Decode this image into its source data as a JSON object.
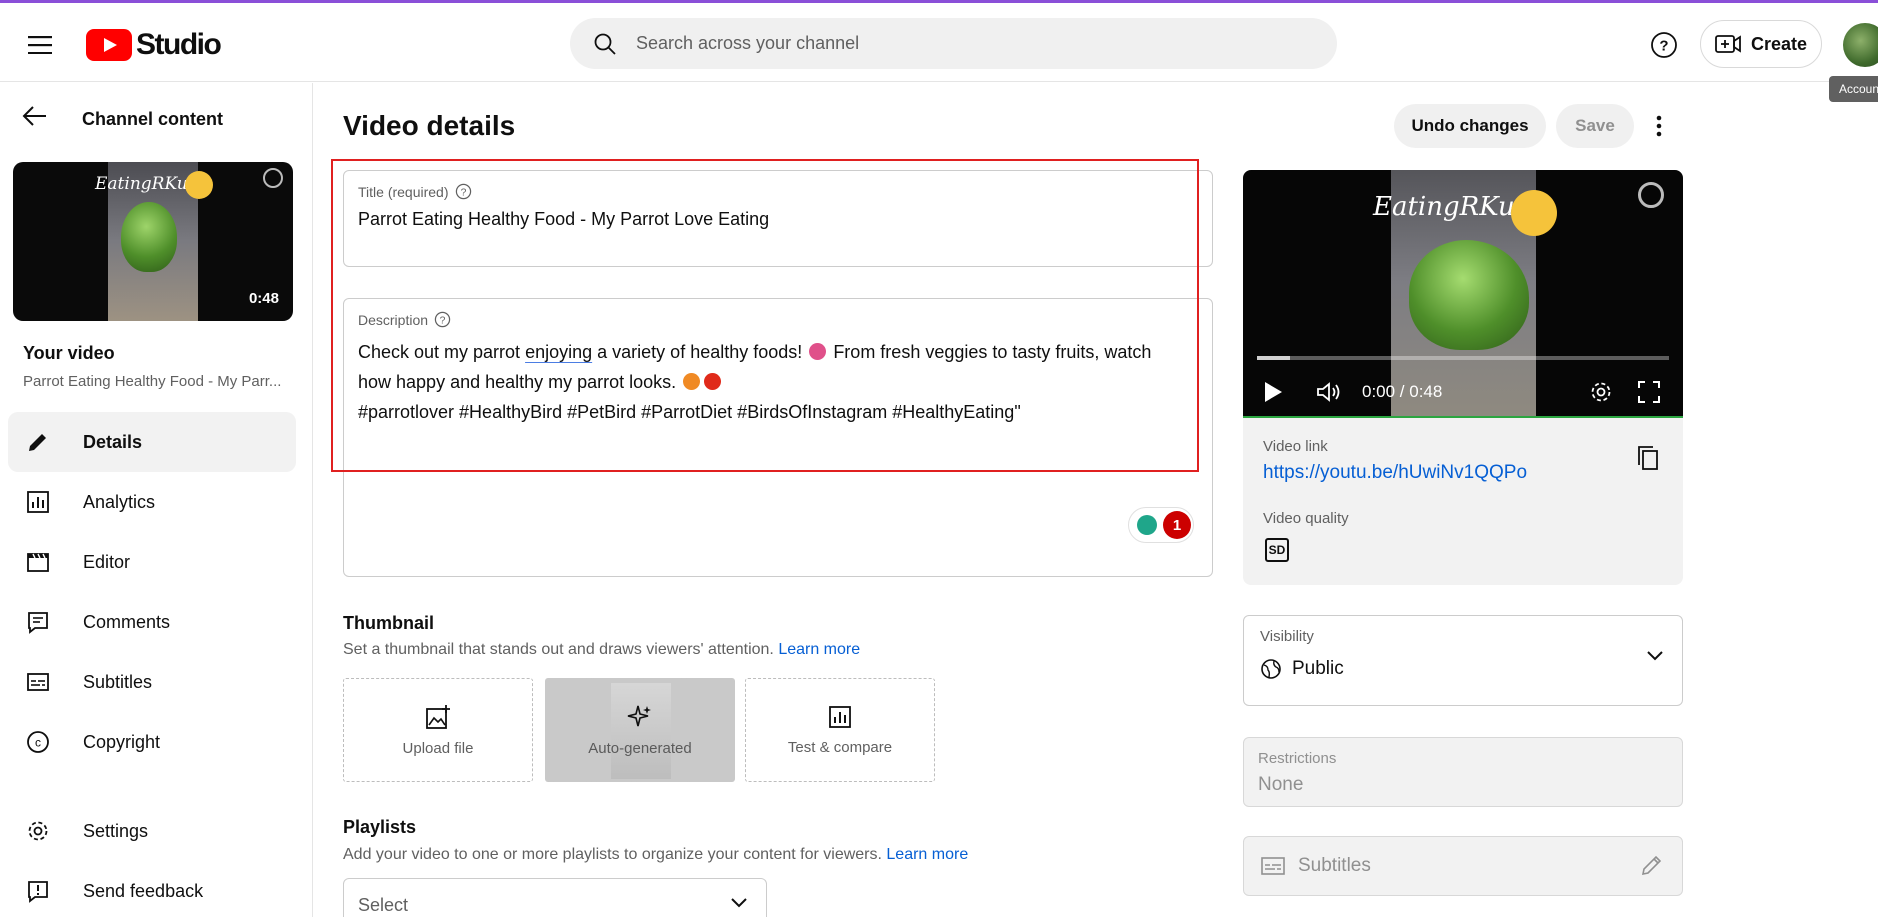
{
  "header": {
    "logo_text": "Studio",
    "search_placeholder": "Search across your channel",
    "create_label": "Create",
    "account_tooltip": "Account"
  },
  "sidebar": {
    "back_label": "Channel content",
    "thumb_duration": "0:48",
    "thumb_overlay_text": "EatingRKuti",
    "your_video_label": "Your video",
    "your_video_title": "Parrot Eating Healthy Food - My Parr...",
    "nav": [
      {
        "label": "Details",
        "icon": "pencil-icon",
        "active": true
      },
      {
        "label": "Analytics",
        "icon": "analytics-icon"
      },
      {
        "label": "Editor",
        "icon": "clapperboard-icon"
      },
      {
        "label": "Comments",
        "icon": "comment-icon"
      },
      {
        "label": "Subtitles",
        "icon": "subtitles-icon"
      },
      {
        "label": "Copyright",
        "icon": "copyright-icon"
      },
      {
        "label": "Settings",
        "icon": "gear-icon"
      },
      {
        "label": "Send feedback",
        "icon": "feedback-icon"
      }
    ]
  },
  "main": {
    "page_title": "Video details",
    "undo_label": "Undo changes",
    "save_label": "Save",
    "title_field": {
      "label": "Title (required)",
      "value": "Parrot Eating Healthy Food - My Parrot Love Eating"
    },
    "description": {
      "label": "Description",
      "line1_a": "Check out my parrot",
      "line1_underlined": "enjoying",
      "line1_b": "a variety of healthy foods!",
      "line1_c": "From fresh veggies to tasty fruits, watch",
      "line2": "how happy and healthy my parrot looks.",
      "line3": "#parrotlover #HealthyBird #PetBird #ParrotDiet #BirdsOfInstagram #HealthyEating\"",
      "badge_count": "1"
    },
    "thumbnail": {
      "title": "Thumbnail",
      "subtitle": "Set a thumbnail that stands out and draws viewers' attention.",
      "learn_more": "Learn more",
      "options": [
        "Upload file",
        "Auto-generated",
        "Test & compare"
      ]
    },
    "playlists": {
      "title": "Playlists",
      "subtitle": "Add your video to one or more playlists to organize your content for viewers.",
      "learn_more": "Learn more",
      "select_value": "Select"
    }
  },
  "video_card": {
    "overlay_text": "EatingRKuti",
    "time": "0:00 / 0:48",
    "progress_fraction": 0.08,
    "video_link_label": "Video link",
    "video_link": "https://youtu.be/hUwiNv1QQPo",
    "video_quality_label": "Video quality",
    "quality_badge": "SD"
  },
  "visibility": {
    "label": "Visibility",
    "value": "Public"
  },
  "restrictions": {
    "label": "Restrictions",
    "value": "None"
  },
  "subtitles": {
    "label": "Subtitles"
  },
  "colors": {
    "brand_red": "#ff0000",
    "link": "#065fd4",
    "highlight_box": "#e02020",
    "accent_purple": "#8a4fd8"
  }
}
